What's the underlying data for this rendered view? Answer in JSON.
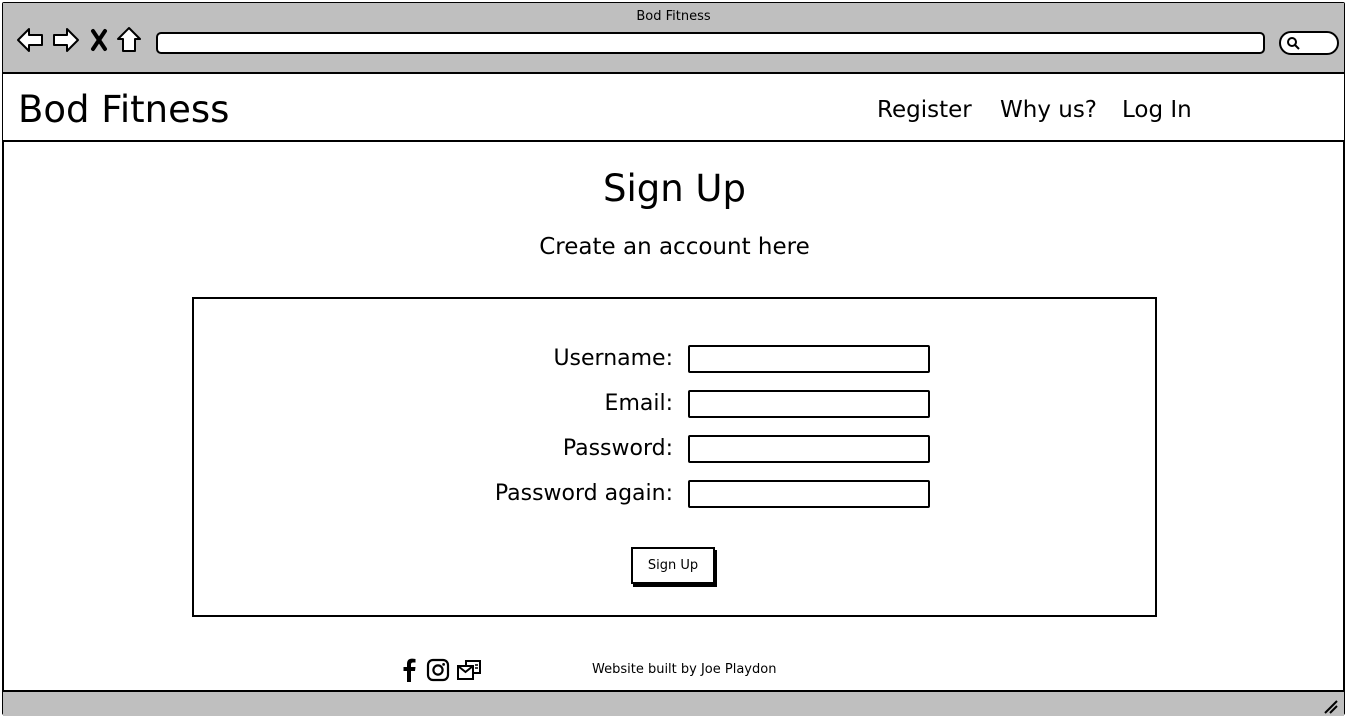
{
  "window": {
    "title": "Bod Fitness"
  },
  "browser": {
    "icons": [
      "back-arrow-icon",
      "forward-arrow-icon",
      "close-x-icon",
      "home-icon",
      "search-icon"
    ],
    "chrome_color": "#bfbfbf"
  },
  "header": {
    "brand": "Bod Fitness",
    "nav": [
      {
        "label": "Register"
      },
      {
        "label": "Why us?"
      },
      {
        "label": "Log In"
      }
    ]
  },
  "main": {
    "title": "Sign Up",
    "subtitle": "Create an account here",
    "form": {
      "fields": [
        {
          "label": "Username:",
          "value": ""
        },
        {
          "label": "Email:",
          "value": ""
        },
        {
          "label": "Password:",
          "value": ""
        },
        {
          "label": "Password again:",
          "value": ""
        }
      ],
      "submit_label": "Sign Up"
    }
  },
  "footer": {
    "social_icons": [
      "facebook-icon",
      "instagram-icon",
      "email-icon"
    ],
    "credit": "Website built by Joe Playdon"
  }
}
